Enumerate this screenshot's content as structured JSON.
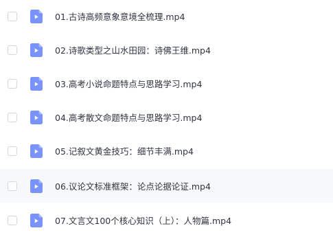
{
  "file_list": {
    "icon": "video-file-icon",
    "colors": {
      "icon": "#7a93fb",
      "icon_fold": "#a9b9fd",
      "text": "#2f3440",
      "checkbox_border": "#d4d6db",
      "hover_row": "#f7f8fa"
    },
    "items": [
      {
        "name": "01.古诗高频意象意境全梳理.mp4"
      },
      {
        "name": "02.诗歌类型之山水田园：诗佛王维.mp4"
      },
      {
        "name": "03.高考小说命题特点与思路学习.mp4"
      },
      {
        "name": "04.高考散文命题特点与思路学习.mp4"
      },
      {
        "name": "05.记叙文黄金技巧：细节丰满.mp4"
      },
      {
        "name": "06.议论文标准框架：论点论据论证.mp4"
      },
      {
        "name": "07.文言文100个核心知识（上）：人物篇.mp4"
      }
    ]
  }
}
